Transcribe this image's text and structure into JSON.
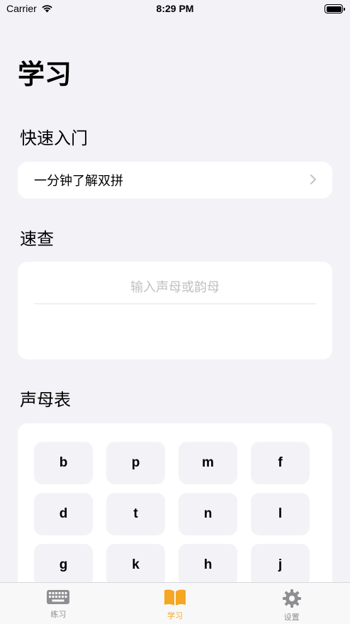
{
  "status_bar": {
    "carrier": "Carrier",
    "time": "8:29 PM"
  },
  "page_title": "学习",
  "quick_start": {
    "title": "快速入门",
    "item_label": "一分钟了解双拼"
  },
  "lookup": {
    "title": "速查",
    "placeholder": "输入声母或韵母",
    "value": ""
  },
  "initials": {
    "title": "声母表",
    "keys": [
      "b",
      "p",
      "m",
      "f",
      "d",
      "t",
      "n",
      "l",
      "g",
      "k",
      "h",
      "j"
    ]
  },
  "tabs": [
    {
      "label": "练习",
      "icon": "keyboard-icon",
      "active": false
    },
    {
      "label": "学习",
      "icon": "book-icon",
      "active": true
    },
    {
      "label": "设置",
      "icon": "gear-icon",
      "active": false
    }
  ],
  "colors": {
    "accent": "#f5a623",
    "inactive": "#8e8e93",
    "background": "#f2f2f7",
    "card": "#ffffff"
  }
}
